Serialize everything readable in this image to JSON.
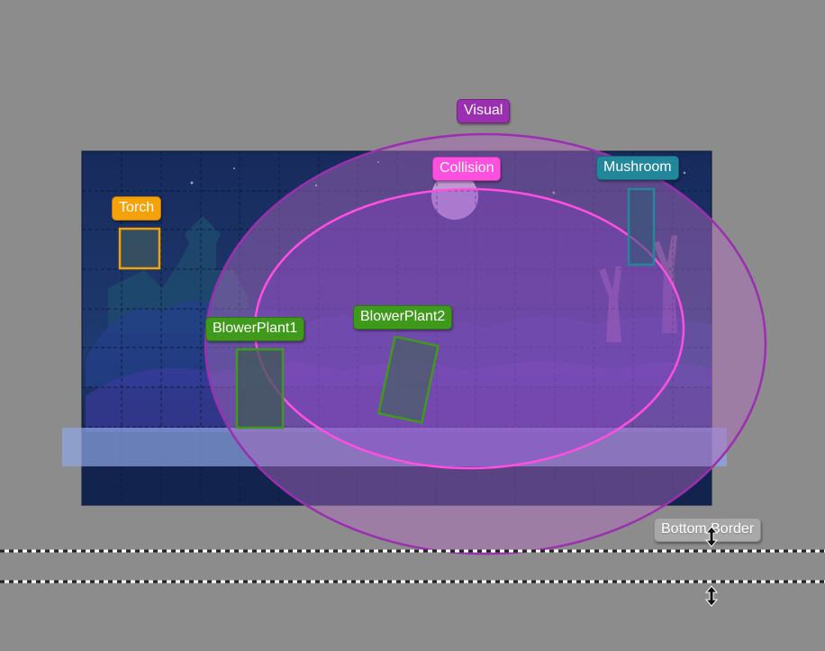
{
  "labels": {
    "visual": "Visual",
    "collision": "Collision",
    "mushroom": "Mushroom",
    "torch": "Torch",
    "blower_plant_1": "BlowerPlant1",
    "blower_plant_2": "BlowerPlant2",
    "bottom_border": "Bottom Border"
  },
  "colors": {
    "canvas_background": "#8c8c8c",
    "scene_background": "#1b2c5e",
    "visual": "#9a2fb0",
    "collision": "#ff4fe0",
    "mushroom": "#23879c",
    "torch": "#f5a10a",
    "blower_plant": "#3f9a1c",
    "bottom_border": "#a8a8a8",
    "ground_band": "#7f9ad8"
  },
  "icons": [
    "vertical-resize-icon",
    "vertical-resize-icon"
  ]
}
